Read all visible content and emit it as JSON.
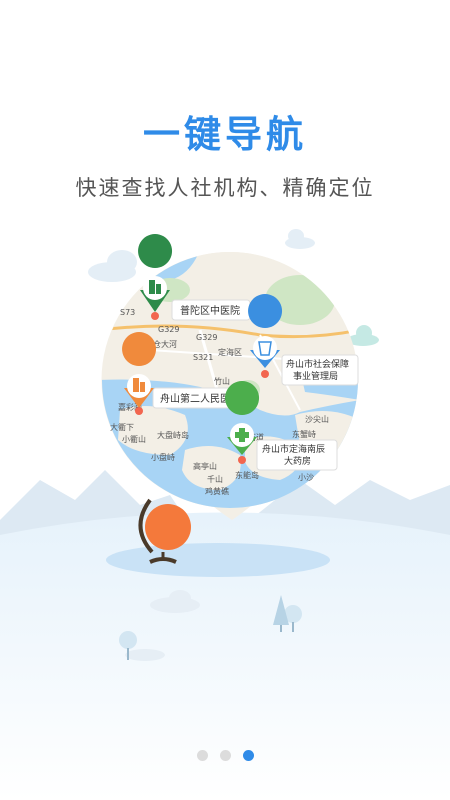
{
  "header": {
    "title": "一键导航",
    "subtitle": "快速查找人社机构、精确定位"
  },
  "map": {
    "places": [
      {
        "label": "普陀区中医院",
        "icon": "building-icon",
        "color": "#2e8b4a"
      },
      {
        "label": "舟山第二人民医院",
        "icon": "building-icon",
        "color": "#f08a3c"
      },
      {
        "label": "舟山市社会保障事业管理局",
        "lines": [
          "舟山市社会保障",
          "事业管理局"
        ],
        "icon": "labor-icon",
        "color": "#3b8fe0"
      },
      {
        "label": "舟山市定海南辰大药房",
        "lines": [
          "舟山市定海南辰",
          "大药房"
        ],
        "icon": "pharmacy-cross-icon",
        "color": "#4cae4c"
      }
    ],
    "map_texts": [
      "盐仓大河",
      "定海区",
      "嘉彩画",
      "大盘峙岛",
      "小盘峙",
      "高亭山",
      "千山",
      "东能岛",
      "鸡黄礁",
      "沙尖山",
      "东蟹峙",
      "石道",
      "竹山",
      "大衢下",
      "小衢山",
      "S73",
      "G329",
      "G329",
      "S321",
      "小沙"
    ]
  },
  "pagination": {
    "count": 3,
    "active": 2
  }
}
